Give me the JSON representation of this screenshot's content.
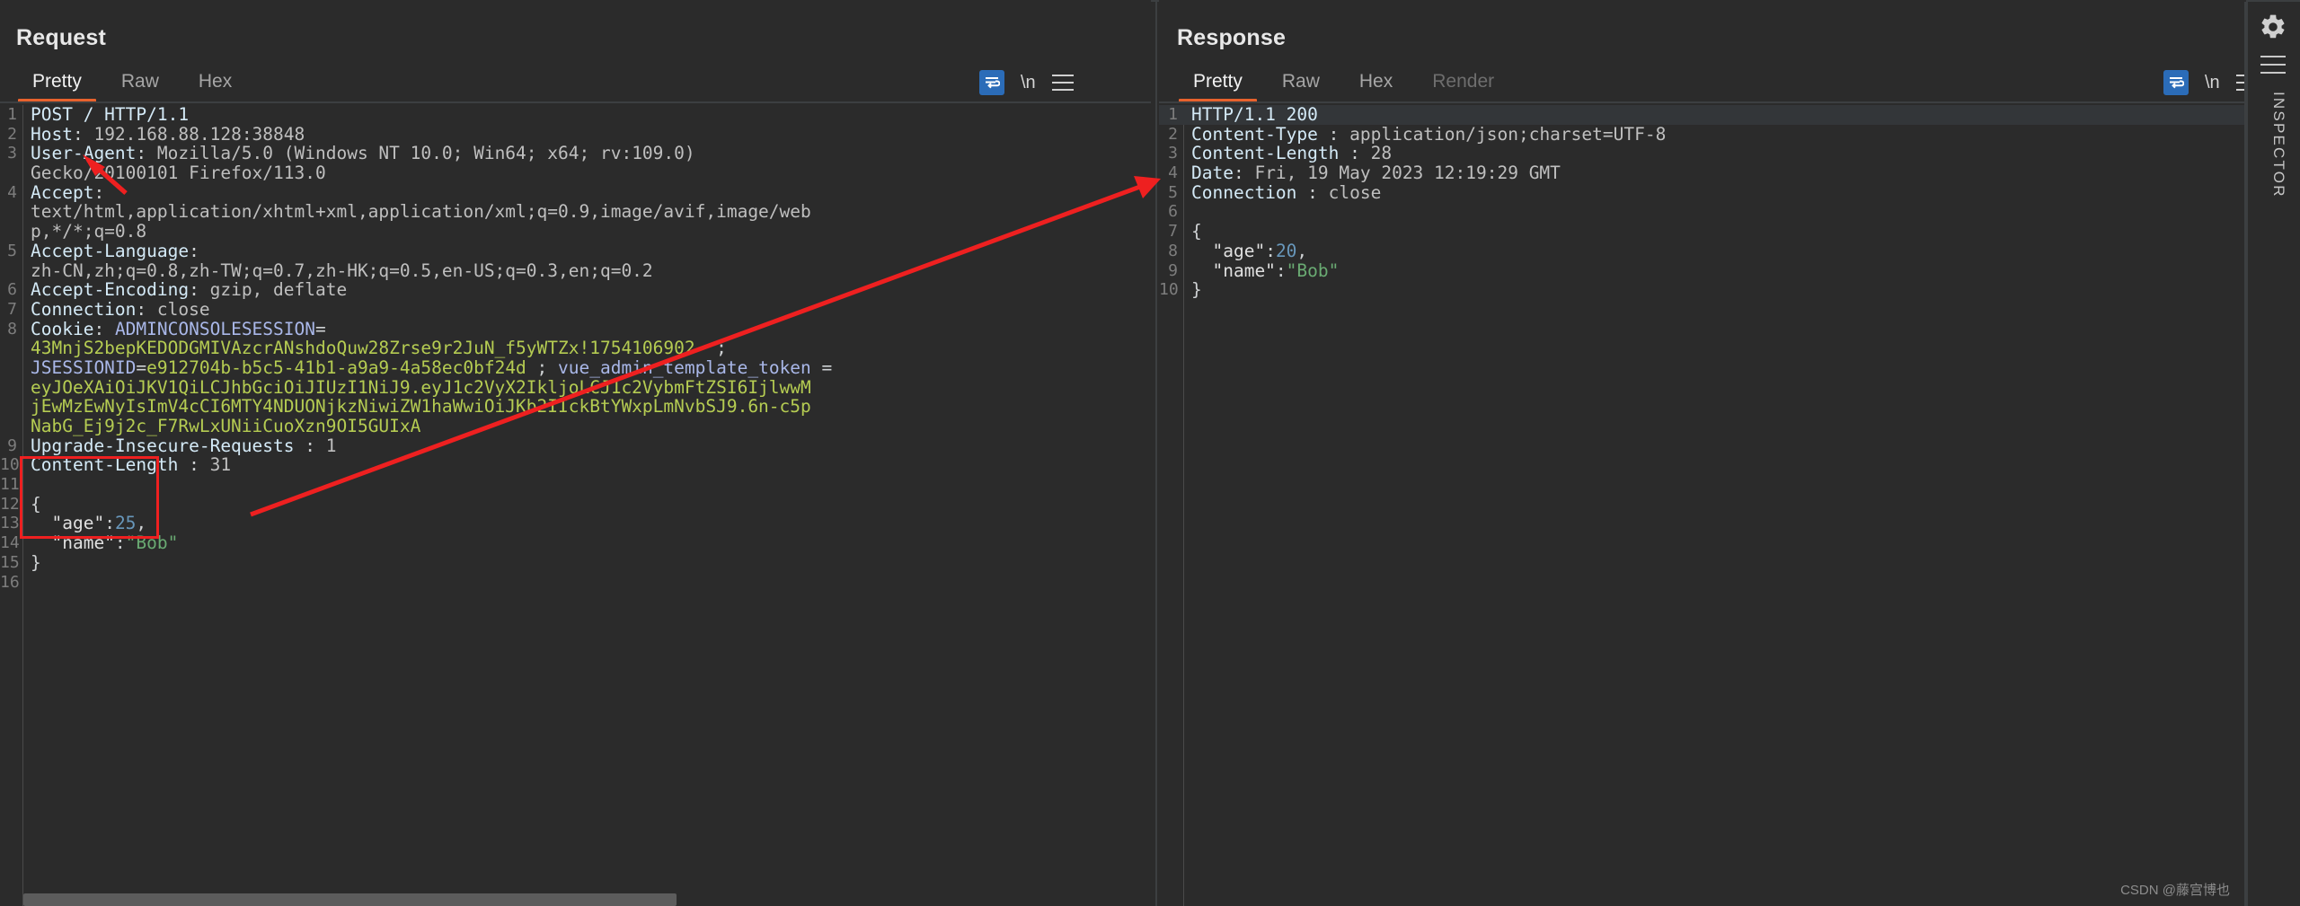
{
  "window": {
    "theme_bg": "#2b2b2b",
    "accent": "#e8622d",
    "highlight_blue": "#2b6cb8",
    "annotation_red": "#ee2020"
  },
  "request": {
    "title": "Request",
    "tabs": [
      {
        "label": "Pretty",
        "active": true
      },
      {
        "label": "Raw",
        "active": false
      },
      {
        "label": "Hex",
        "active": false
      }
    ],
    "tools": {
      "wrap_icon": "word-wrap-icon",
      "newline_label": "\\n",
      "menu_icon": "hamburger-menu-icon"
    },
    "lines": [
      {
        "n": "1",
        "segments": [
          {
            "t": "POST / HTTP/1.1",
            "c": "t-key"
          }
        ]
      },
      {
        "n": "2",
        "segments": [
          {
            "t": "Host",
            "c": "t-key"
          },
          {
            "t": ": ",
            "c": "t-punct"
          },
          {
            "t": "192.168.88.128:38848",
            "c": "t-val"
          }
        ]
      },
      {
        "n": "3",
        "segments": [
          {
            "t": "User-Agent",
            "c": "t-key"
          },
          {
            "t": ": ",
            "c": "t-punct"
          },
          {
            "t": "Mozilla/5.0 (Windows NT 10.0; Win64; x64; rv:109.0)",
            "c": "t-val"
          }
        ]
      },
      {
        "n": "",
        "segments": [
          {
            "t": "Gecko/20100101 Firefox/113.0",
            "c": "t-val"
          }
        ]
      },
      {
        "n": "4",
        "segments": [
          {
            "t": "Accept",
            "c": "t-key"
          },
          {
            "t": ": ",
            "c": "t-punct"
          }
        ]
      },
      {
        "n": "",
        "segments": [
          {
            "t": "text/html,application/xhtml+xml,application/xml;q=0.9,image/avif,image/web",
            "c": "t-val"
          }
        ]
      },
      {
        "n": "",
        "segments": [
          {
            "t": "p,*/*;q=0.8",
            "c": "t-val"
          }
        ]
      },
      {
        "n": "5",
        "segments": [
          {
            "t": "Accept-Language",
            "c": "t-key"
          },
          {
            "t": ": ",
            "c": "t-punct"
          }
        ]
      },
      {
        "n": "",
        "segments": [
          {
            "t": "zh-CN,zh;q=0.8,zh-TW;q=0.7,zh-HK;q=0.5,en-US;q=0.3,en;q=0.2",
            "c": "t-val"
          }
        ]
      },
      {
        "n": "6",
        "segments": [
          {
            "t": "Accept-Encoding",
            "c": "t-key"
          },
          {
            "t": ": ",
            "c": "t-punct"
          },
          {
            "t": "gzip, deflate",
            "c": "t-val"
          }
        ]
      },
      {
        "n": "7",
        "segments": [
          {
            "t": "Connection",
            "c": "t-key"
          },
          {
            "t": ": ",
            "c": "t-punct"
          },
          {
            "t": "close",
            "c": "t-val"
          }
        ]
      },
      {
        "n": "8",
        "segments": [
          {
            "t": "Cookie",
            "c": "t-key"
          },
          {
            "t": ": ",
            "c": "t-punct"
          },
          {
            "t": "ADMINCONSOLESESSION",
            "c": "t-cookie-name"
          },
          {
            "t": "=",
            "c": "t-punct"
          }
        ]
      },
      {
        "n": "",
        "segments": [
          {
            "t": "43MnjS2bepKEDODGMIVAzcrANshdoQuw28Zrse9r2JuN_f5yWTZx!1754106902",
            "c": "t-cookie-val"
          },
          {
            "t": "  ;",
            "c": "t-punct"
          }
        ]
      },
      {
        "n": "",
        "segments": [
          {
            "t": "JSESSIONID",
            "c": "t-cookie-name"
          },
          {
            "t": "=",
            "c": "t-punct"
          },
          {
            "t": "e912704b-b5c5-41b1-a9a9-4a58ec0bf24d",
            "c": "t-cookie-val"
          },
          {
            "t": " ; ",
            "c": "t-punct"
          },
          {
            "t": "vue_admin_template_token",
            "c": "t-cookie-name"
          },
          {
            "t": " =",
            "c": "t-punct"
          }
        ]
      },
      {
        "n": "",
        "segments": [
          {
            "t": "eyJOeXAiOiJKV1QiLCJhbGciOiJIUzI1NiJ9.eyJ1c2VyX2Ikljo",
            "c": "t-cookie-val"
          },
          {
            "t": "LCJ1c2VybmFtZSI6IjlwwM",
            "c": "t-cookie-val"
          }
        ]
      },
      {
        "n": "",
        "segments": [
          {
            "t": "jEwMzEwNyIsImV4cCI6MTY4NDUONjkzNiwiZW1haWwiOiJKb2IIckBtYWxpLmNvbSJ9.6n-c5p",
            "c": "t-cookie-val"
          }
        ]
      },
      {
        "n": "",
        "segments": [
          {
            "t": "NabG_Ej9j2c_F7RwLxUNiiCuoXzn9OI5GUIxA",
            "c": "t-cookie-val"
          }
        ]
      },
      {
        "n": "9",
        "segments": [
          {
            "t": "Upgrade-Insecure-Requests",
            "c": "t-key"
          },
          {
            "t": " : ",
            "c": "t-punct"
          },
          {
            "t": "1",
            "c": "t-val"
          }
        ]
      },
      {
        "n": "10",
        "segments": [
          {
            "t": "Content-Length",
            "c": "t-key"
          },
          {
            "t": " : ",
            "c": "t-punct"
          },
          {
            "t": "31",
            "c": "t-val"
          }
        ]
      },
      {
        "n": "11",
        "segments": []
      },
      {
        "n": "12",
        "segments": [
          {
            "t": "{",
            "c": "t-punct"
          }
        ]
      },
      {
        "n": "13",
        "segments": [
          {
            "t": "  \"age\"",
            "c": "t-jsonkey"
          },
          {
            "t": ":",
            "c": "t-punct"
          },
          {
            "t": "25",
            "c": "t-jsonnum"
          },
          {
            "t": ",",
            "c": "t-punct"
          }
        ]
      },
      {
        "n": "14",
        "segments": [
          {
            "t": "  \"name\"",
            "c": "t-jsonkey"
          },
          {
            "t": ":",
            "c": "t-punct"
          },
          {
            "t": "\"Bob\"",
            "c": "t-jsonstr"
          }
        ]
      },
      {
        "n": "15",
        "segments": [
          {
            "t": "}",
            "c": "t-punct"
          }
        ]
      },
      {
        "n": "16",
        "segments": []
      }
    ]
  },
  "response": {
    "title": "Response",
    "tabs": [
      {
        "label": "Pretty",
        "active": true,
        "disabled": false
      },
      {
        "label": "Raw",
        "active": false,
        "disabled": false
      },
      {
        "label": "Hex",
        "active": false,
        "disabled": false
      },
      {
        "label": "Render",
        "active": false,
        "disabled": true
      }
    ],
    "tools": {
      "wrap_icon": "word-wrap-icon",
      "newline_label": "\\n",
      "menu_icon": "hamburger-menu-icon"
    },
    "lines": [
      {
        "n": "1",
        "highlight": true,
        "segments": [
          {
            "t": "HTTP/1.1 200",
            "c": "t-status"
          }
        ]
      },
      {
        "n": "2",
        "highlight": false,
        "segments": [
          {
            "t": "Content-Type",
            "c": "t-key"
          },
          {
            "t": " : ",
            "c": "t-punct"
          },
          {
            "t": "application/json;charset=UTF-8",
            "c": "t-val"
          }
        ]
      },
      {
        "n": "3",
        "highlight": false,
        "segments": [
          {
            "t": "Content-Length",
            "c": "t-key"
          },
          {
            "t": " : ",
            "c": "t-punct"
          },
          {
            "t": "28",
            "c": "t-val"
          }
        ]
      },
      {
        "n": "4",
        "highlight": false,
        "segments": [
          {
            "t": "Date",
            "c": "t-key"
          },
          {
            "t": ": ",
            "c": "t-punct"
          },
          {
            "t": "Fri, 19 May 2023 12:19:29 GMT",
            "c": "t-val"
          }
        ]
      },
      {
        "n": "5",
        "highlight": false,
        "segments": [
          {
            "t": "Connection",
            "c": "t-key"
          },
          {
            "t": " : ",
            "c": "t-punct"
          },
          {
            "t": "close",
            "c": "t-val"
          }
        ]
      },
      {
        "n": "6",
        "highlight": false,
        "segments": []
      },
      {
        "n": "7",
        "highlight": false,
        "segments": [
          {
            "t": "{",
            "c": "t-punct"
          }
        ]
      },
      {
        "n": "8",
        "highlight": false,
        "segments": [
          {
            "t": "  \"age\"",
            "c": "t-jsonkey"
          },
          {
            "t": ":",
            "c": "t-punct"
          },
          {
            "t": "20",
            "c": "t-jsonnum"
          },
          {
            "t": ",",
            "c": "t-punct"
          }
        ]
      },
      {
        "n": "9",
        "highlight": false,
        "segments": [
          {
            "t": "  \"name\"",
            "c": "t-jsonkey"
          },
          {
            "t": ":",
            "c": "t-punct"
          },
          {
            "t": "\"Bob\"",
            "c": "t-jsonstr"
          }
        ]
      },
      {
        "n": "10",
        "highlight": false,
        "segments": [
          {
            "t": "}",
            "c": "t-punct"
          }
        ]
      }
    ]
  },
  "layout_buttons": [
    {
      "name": "layout-side-by-side",
      "active": true
    },
    {
      "name": "layout-stacked",
      "active": false
    },
    {
      "name": "layout-single",
      "active": false
    }
  ],
  "inspector": {
    "label": "INSPECTOR",
    "gear_icon": "gear-icon",
    "menu_icon": "hamburger-menu-icon"
  },
  "annotations": {
    "red_box_name": "request-body-highlight-box",
    "arrow_long_name": "arrow-request-body-to-response-body",
    "arrow_short_name": "arrow-pointing-to-host-header"
  },
  "watermark": "CSDN @藤宫博也"
}
